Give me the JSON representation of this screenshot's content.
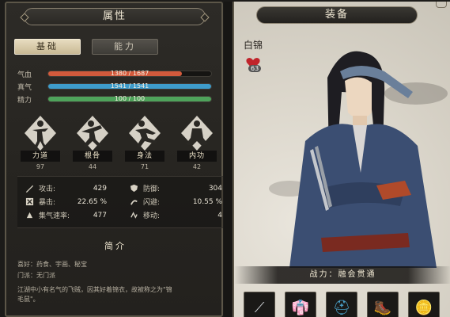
{
  "left": {
    "header": "属性",
    "tabs": [
      {
        "label": "基础",
        "active": true
      },
      {
        "label": "能力",
        "active": false
      }
    ],
    "bars": [
      {
        "label": "气血",
        "text": "1380 / 1687",
        "fraction": 0.818,
        "color": "#d25a3c"
      },
      {
        "label": "真气",
        "text": "1541 / 1541",
        "fraction": 1.0,
        "color": "#3e9ccb"
      },
      {
        "label": "精力",
        "text": "100 / 100",
        "fraction": 1.0,
        "color": "#4ea35b"
      }
    ],
    "attributes": [
      {
        "name": "力道",
        "value": "97",
        "icon": "strength-pose-icon"
      },
      {
        "name": "根骨",
        "value": "44",
        "icon": "constitution-pose-icon"
      },
      {
        "name": "身法",
        "value": "71",
        "icon": "agility-pose-icon"
      },
      {
        "name": "内功",
        "value": "42",
        "icon": "inner-power-pose-icon"
      }
    ],
    "sub_stats": [
      {
        "label": "攻击:",
        "value": "429",
        "icon": "attack-sword-icon"
      },
      {
        "label": "防御:",
        "value": "304",
        "icon": "defense-shield-icon"
      },
      {
        "label": "暴击:",
        "value": "22.65 %",
        "icon": "crit-icon"
      },
      {
        "label": "闪避:",
        "value": "10.55 %",
        "icon": "dodge-icon"
      },
      {
        "label": "集气速率:",
        "value": "477",
        "icon": "qi-rate-icon"
      },
      {
        "label": "移动:",
        "value": "4",
        "icon": "move-icon"
      }
    ],
    "intro_title": "简介",
    "intro_lines": [
      "喜好：药食、宇画、秘宝",
      "门派：无门派",
      "江湖中小有名气的飞贼，因其好着锦衣，故被称之为\"锦",
      "毛鼠\"。"
    ]
  },
  "right": {
    "header": "装备",
    "char_name": "白锦",
    "heart_value": "63",
    "power_text": "战力：融会贯通",
    "slots": [
      {
        "icon": "spear-weapon-icon",
        "glyph": "⟋"
      },
      {
        "icon": "purple-robe-icon",
        "glyph": "👘"
      },
      {
        "icon": "helmet-icon",
        "glyph": "⛑"
      },
      {
        "icon": "boots-icon",
        "glyph": "🥾"
      },
      {
        "icon": "amulet-icon",
        "glyph": "🪙"
      }
    ]
  },
  "colors": {
    "panel_dark": "#2d2b27",
    "border": "#5c5648",
    "hp": "#d25a3c",
    "mp": "#3e9ccb",
    "stamina": "#4ea35b"
  }
}
